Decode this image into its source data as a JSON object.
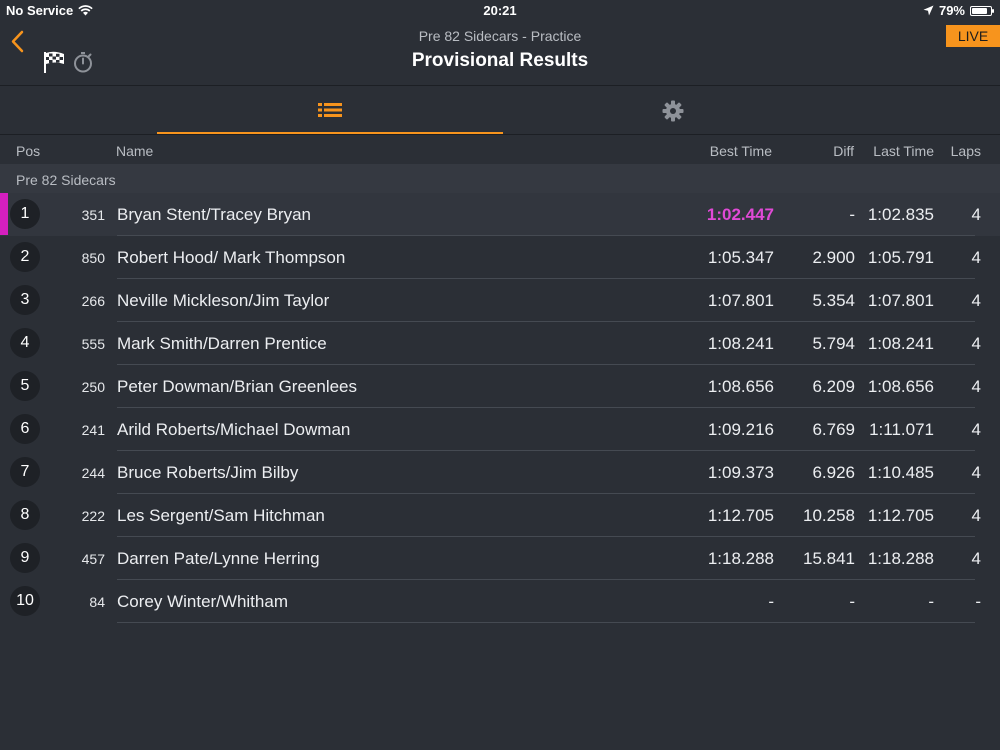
{
  "status_bar": {
    "carrier": "No Service",
    "time": "20:21",
    "battery": "79%"
  },
  "header": {
    "subtitle": "Pre 82 Sidecars - Practice",
    "title": "Provisional Results",
    "live_label": "LIVE"
  },
  "icons": {
    "back": "chevron-left-icon",
    "flag": "checkered-flag-icon",
    "stopwatch": "stopwatch-icon",
    "list": "list-icon",
    "settings": "gear-icon"
  },
  "colors": {
    "accent": "#f7941d",
    "leader_marker": "#d51fbf",
    "best_time_highlight": "#e04ad6",
    "background": "#2b2f36"
  },
  "columns": {
    "pos": "Pos",
    "name": "Name",
    "best_time": "Best Time",
    "diff": "Diff",
    "last_time": "Last Time",
    "laps": "Laps"
  },
  "group_label": "Pre 82 Sidecars",
  "rows": [
    {
      "pos": "1",
      "num": "351",
      "name": "Bryan Stent/Tracey Bryan",
      "best": "1:02.447",
      "diff": "-",
      "last": "1:02.835",
      "laps": "4"
    },
    {
      "pos": "2",
      "num": "850",
      "name": "Robert Hood/ Mark Thompson",
      "best": "1:05.347",
      "diff": "2.900",
      "last": "1:05.791",
      "laps": "4"
    },
    {
      "pos": "3",
      "num": "266",
      "name": "Neville Mickleson/Jim Taylor",
      "best": "1:07.801",
      "diff": "5.354",
      "last": "1:07.801",
      "laps": "4"
    },
    {
      "pos": "4",
      "num": "555",
      "name": "Mark Smith/Darren Prentice",
      "best": "1:08.241",
      "diff": "5.794",
      "last": "1:08.241",
      "laps": "4"
    },
    {
      "pos": "5",
      "num": "250",
      "name": "Peter Dowman/Brian Greenlees",
      "best": "1:08.656",
      "diff": "6.209",
      "last": "1:08.656",
      "laps": "4"
    },
    {
      "pos": "6",
      "num": "241",
      "name": "Arild Roberts/Michael Dowman",
      "best": "1:09.216",
      "diff": "6.769",
      "last": "1:11.071",
      "laps": "4"
    },
    {
      "pos": "7",
      "num": "244",
      "name": "Bruce Roberts/Jim Bilby",
      "best": "1:09.373",
      "diff": "6.926",
      "last": "1:10.485",
      "laps": "4"
    },
    {
      "pos": "8",
      "num": "222",
      "name": "Les Sergent/Sam Hitchman",
      "best": "1:12.705",
      "diff": "10.258",
      "last": "1:12.705",
      "laps": "4"
    },
    {
      "pos": "9",
      "num": "457",
      "name": "Darren Pate/Lynne Herring",
      "best": "1:18.288",
      "diff": "15.841",
      "last": "1:18.288",
      "laps": "4"
    },
    {
      "pos": "10",
      "num": "84",
      "name": "Corey Winter/Whitham",
      "best": "-",
      "diff": "-",
      "last": "-",
      "laps": "-"
    }
  ]
}
